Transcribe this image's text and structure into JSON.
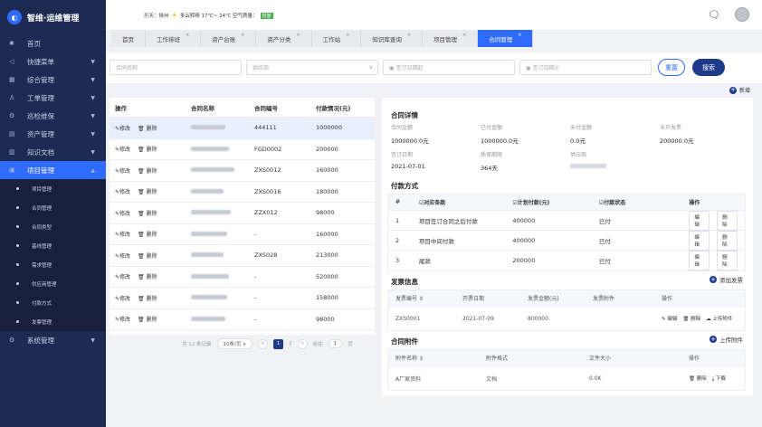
{
  "app": {
    "title": "智维·运维管理",
    "logo_glyph": "◐"
  },
  "sidebar": {
    "items": [
      {
        "icon": "✱",
        "label": "首页",
        "arrow": ""
      },
      {
        "icon": "◁",
        "label": "快捷菜单",
        "arrow": "▼"
      },
      {
        "icon": "▦",
        "label": "综合管理",
        "arrow": "▼"
      },
      {
        "icon": "♙",
        "label": "工单管理",
        "arrow": "▼"
      },
      {
        "icon": "⚙",
        "label": "巡检维保",
        "arrow": "▼"
      },
      {
        "icon": "▤",
        "label": "资产管理",
        "arrow": "▼"
      },
      {
        "icon": "▥",
        "label": "知识文档",
        "arrow": "▼"
      },
      {
        "icon": "▣",
        "label": "项目管理",
        "arrow": "▲"
      }
    ],
    "sub_items": [
      "项目管理",
      "合同管理",
      "合同类型",
      "基线管理",
      "需求管理",
      "供应商管理",
      "付款方式",
      "发票管理"
    ],
    "bottom": {
      "icon": "⚙",
      "label": "系统管理",
      "arrow": "▼"
    }
  },
  "topbar": {
    "weather_city": "乐天：徐州",
    "weather_icon": "☀",
    "weather_desc": "多云转晴 17℃~ 24℃ 空气质量：",
    "air_quality": "轻度",
    "msg_icon": "🗨"
  },
  "tabs": [
    {
      "label": "首页",
      "closable": false
    },
    {
      "label": "工作排班",
      "closable": true
    },
    {
      "label": "资产台账",
      "closable": true
    },
    {
      "label": "资产分类",
      "closable": true
    },
    {
      "label": "工作站",
      "closable": true
    },
    {
      "label": "知识库查询",
      "closable": true
    },
    {
      "label": "项目管理",
      "closable": true
    },
    {
      "label": "合同管理",
      "closable": true
    }
  ],
  "filters": {
    "contract_name_placeholder": "合同名称",
    "supplier_placeholder": "供应商",
    "sign_start_placeholder": "▣ 签订日期起",
    "sign_end_placeholder": "▣ 签订日期止",
    "select_caret": "∨",
    "reset_label": "重置",
    "search_label": "搜索"
  },
  "add_label": "新增",
  "contract_table": {
    "headers": [
      "操作",
      "合同名称",
      "合同编号",
      "付款情况(元)"
    ],
    "edit_label": "✎修改",
    "delete_label": "🗑 删除",
    "rows": [
      {
        "code": "444111",
        "pay": "1000000"
      },
      {
        "code": "FGD0002",
        "pay": "200000"
      },
      {
        "code": "ZXS0012",
        "pay": "160000"
      },
      {
        "code": "ZXS0016",
        "pay": "180000"
      },
      {
        "code": "ZZX012",
        "pay": "98000"
      },
      {
        "code": "-",
        "pay": "160000"
      },
      {
        "code": "ZXS028",
        "pay": "213000"
      },
      {
        "code": "-",
        "pay": "520000"
      },
      {
        "code": "-",
        "pay": "158000"
      },
      {
        "code": "-",
        "pay": "98000"
      }
    ]
  },
  "pager": {
    "total": "共 12 条记录",
    "page_size": "10条/页 ∨",
    "prev": "<",
    "current": "1",
    "next_page": "2",
    "next": ">",
    "goto": "前往",
    "goto_page": "1",
    "page_unit": "页"
  },
  "detail": {
    "title": "合同详情",
    "labels": [
      "合同金额",
      "已付金额",
      "未付金额",
      "未开发票",
      "签订日期",
      "质保期限",
      "供应商"
    ],
    "contract_amount": "1000000.0元",
    "paid_amount": "1000000.0元",
    "unpaid_amount": "0.0元",
    "uninvoiced": "200000.0元",
    "sign_date": "2021-07-01",
    "warranty": "364天"
  },
  "payment": {
    "title": "付款方式",
    "headers": [
      "#",
      "☑对应条款",
      "☑计划付款(元)",
      "☑付款状态",
      "操作"
    ],
    "edit_label": "编辑",
    "delete_label": "删除",
    "rows": [
      {
        "no": "1",
        "term": "项目签订合同之后付款",
        "amount": "400000",
        "status": "已付"
      },
      {
        "no": "2",
        "term": "项目中间付款",
        "amount": "400000",
        "status": "已付"
      },
      {
        "no": "3",
        "term": "尾款",
        "amount": "200000",
        "status": "已付"
      }
    ]
  },
  "invoice": {
    "title": "发票信息",
    "add_label": "添加发票",
    "headers": [
      "发票编号 ⇕",
      "开票日期",
      "发票金额(元)",
      "发票附件",
      "操作"
    ],
    "rows": [
      {
        "no": "ZXS0001",
        "date": "2021-07-09",
        "amount": "800000",
        "attach": ""
      }
    ],
    "op_edit": "✎ 编辑",
    "op_delete": "🗑 删除",
    "op_upload": "☁ 上传附件"
  },
  "attachments": {
    "title": "合同附件",
    "upload_label": "上传附件",
    "headers": [
      "附件名称 ⇕",
      "附件格式",
      "文件大小",
      "操作"
    ],
    "rows": [
      {
        "name": "A厂家资料",
        "format": "文档",
        "size": "0.0K"
      }
    ],
    "op_delete": "🗑 删除",
    "op_download": "⤓ 下载"
  },
  "colors": {
    "primary": "#2f6bff",
    "sidebar": "#1d2a52",
    "dark_button": "#1e3b8a"
  }
}
